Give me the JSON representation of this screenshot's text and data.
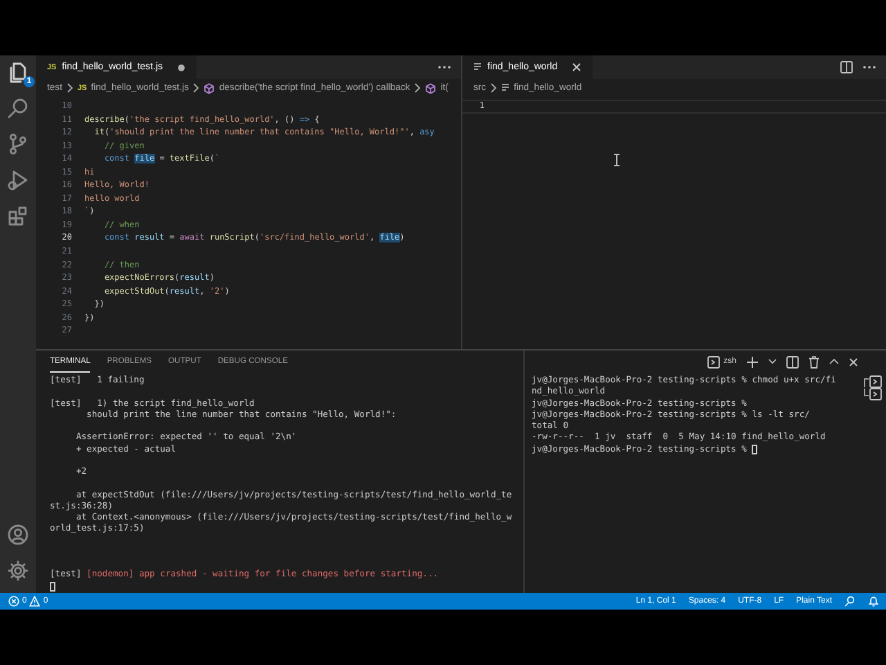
{
  "activity_bar": {
    "explorer_badge": "1"
  },
  "editors": [
    {
      "tab": {
        "badge": "JS",
        "label": "find_hello_world_test.js",
        "modified": true
      },
      "breadcrumbs": [
        {
          "kind": "folder",
          "label": "test"
        },
        {
          "kind": "js",
          "badge": "JS",
          "label": "find_hello_world_test.js"
        },
        {
          "kind": "symbol",
          "label": "describe('the script find_hello_world') callback"
        },
        {
          "kind": "symbol",
          "label": "it("
        }
      ],
      "lines": [
        {
          "number": "10",
          "current": false
        },
        {
          "number": "11",
          "current": false,
          "tokens": [
            {
              "text": "describe",
              "kind": "func"
            },
            {
              "text": "(",
              "kind": "plain"
            },
            {
              "text": "'the script find_hello_world'",
              "kind": "string"
            },
            {
              "text": ", () ",
              "kind": "plain"
            },
            {
              "text": "=>",
              "kind": "keyword"
            },
            {
              "text": " {",
              "kind": "plain"
            }
          ]
        },
        {
          "number": "12",
          "current": false,
          "tokens": [
            {
              "text": "  it",
              "kind": "func"
            },
            {
              "text": "(",
              "kind": "plain"
            },
            {
              "text": "'should print the line number that contains \"Hello, World!\"'",
              "kind": "string"
            },
            {
              "text": ", ",
              "kind": "plain"
            },
            {
              "text": "asy",
              "kind": "keyword"
            }
          ]
        },
        {
          "number": "13",
          "current": false,
          "tokens": [
            {
              "text": "    // given",
              "kind": "comment"
            }
          ]
        },
        {
          "number": "14",
          "current": false,
          "tokens": [
            {
              "text": "    const ",
              "kind": "keyword"
            },
            {
              "text": "file",
              "kind": "match"
            },
            {
              "text": " = ",
              "kind": "plain"
            },
            {
              "text": "textFile",
              "kind": "func"
            },
            {
              "text": "(",
              "kind": "plain"
            },
            {
              "text": "`",
              "kind": "string"
            }
          ]
        },
        {
          "number": "15",
          "current": false,
          "tokens": [
            {
              "text": "hi",
              "kind": "string"
            }
          ]
        },
        {
          "number": "16",
          "current": false,
          "tokens": [
            {
              "text": "Hello, World!",
              "kind": "string"
            }
          ]
        },
        {
          "number": "17",
          "current": false,
          "tokens": [
            {
              "text": "hello world",
              "kind": "string"
            }
          ]
        },
        {
          "number": "18",
          "current": false,
          "tokens": [
            {
              "text": "`",
              "kind": "string"
            },
            {
              "text": ")",
              "kind": "plain"
            }
          ]
        },
        {
          "number": "19",
          "current": false,
          "tokens": [
            {
              "text": "    // when",
              "kind": "comment"
            }
          ]
        },
        {
          "number": "20",
          "current": true,
          "tokens": [
            {
              "text": "    const ",
              "kind": "keyword"
            },
            {
              "text": "result",
              "kind": "var"
            },
            {
              "text": " = ",
              "kind": "plain"
            },
            {
              "text": "await ",
              "kind": "control"
            },
            {
              "text": "runScript",
              "kind": "func"
            },
            {
              "text": "(",
              "kind": "plain"
            },
            {
              "text": "'src/find_hello_world'",
              "kind": "string"
            },
            {
              "text": ", ",
              "kind": "plain"
            },
            {
              "text": "file",
              "kind": "match"
            },
            {
              "text": ")",
              "kind": "plain"
            }
          ]
        },
        {
          "number": "21",
          "current": false
        },
        {
          "number": "22",
          "current": false,
          "tokens": [
            {
              "text": "    // then",
              "kind": "comment"
            }
          ]
        },
        {
          "number": "23",
          "current": false,
          "tokens": [
            {
              "text": "    expectNoErrors",
              "kind": "func"
            },
            {
              "text": "(",
              "kind": "plain"
            },
            {
              "text": "result",
              "kind": "var"
            },
            {
              "text": ")",
              "kind": "plain"
            }
          ]
        },
        {
          "number": "24",
          "current": false,
          "tokens": [
            {
              "text": "    expectStdOut",
              "kind": "func"
            },
            {
              "text": "(",
              "kind": "plain"
            },
            {
              "text": "result",
              "kind": "var"
            },
            {
              "text": ", ",
              "kind": "plain"
            },
            {
              "text": "'2'",
              "kind": "string"
            },
            {
              "text": ")",
              "kind": "plain"
            }
          ]
        },
        {
          "number": "25",
          "current": false,
          "tokens": [
            {
              "text": "  })",
              "kind": "plain"
            }
          ]
        },
        {
          "number": "26",
          "current": false,
          "tokens": [
            {
              "text": "})",
              "kind": "plain"
            }
          ]
        },
        {
          "number": "27",
          "current": false
        }
      ]
    },
    {
      "tab": {
        "label": "find_hello_world",
        "modified": false
      },
      "breadcrumbs": [
        {
          "kind": "folder",
          "label": "src"
        },
        {
          "kind": "file",
          "label": "find_hello_world"
        }
      ],
      "lines": [
        {
          "number": "1",
          "current": true
        }
      ]
    }
  ],
  "panel": {
    "tabs": [
      {
        "label": "TERMINAL",
        "selected": true
      },
      {
        "label": "PROBLEMS",
        "selected": false
      },
      {
        "label": "OUTPUT",
        "selected": false
      },
      {
        "label": "DEBUG CONSOLE",
        "selected": false
      }
    ],
    "shell": "zsh",
    "terminals": [
      {
        "lines": [
          {
            "kind": "text",
            "segments": [
              {
                "text": "[test]   1 failing",
                "kind": "plain"
              }
            ]
          },
          {
            "kind": "blank"
          },
          {
            "kind": "text",
            "segments": [
              {
                "text": "[test]   1) the script find_hello_world",
                "kind": "plain"
              }
            ]
          },
          {
            "kind": "text",
            "segments": [
              {
                "text": "       should print the line number that contains \"Hello, World!\":",
                "kind": "plain"
              }
            ]
          },
          {
            "kind": "blank"
          },
          {
            "kind": "text",
            "segments": [
              {
                "text": "     AssertionError: expected '' to equal '2\\n'",
                "kind": "plain"
              }
            ]
          },
          {
            "kind": "text",
            "segments": [
              {
                "text": "     + expected - actual",
                "kind": "plain"
              }
            ]
          },
          {
            "kind": "blank"
          },
          {
            "kind": "text",
            "segments": [
              {
                "text": "     +2",
                "kind": "plain"
              }
            ]
          },
          {
            "kind": "blank"
          },
          {
            "kind": "text",
            "segments": [
              {
                "text": "     at expectStdOut (file:///Users/jv/projects/testing-scripts/test/find_hello_world_te",
                "kind": "plain"
              }
            ]
          },
          {
            "kind": "text",
            "segments": [
              {
                "text": "st.js:36:28)",
                "kind": "plain"
              }
            ]
          },
          {
            "kind": "text",
            "segments": [
              {
                "text": "     at Context.<anonymous> (file:///Users/jv/projects/testing-scripts/test/find_hello_w",
                "kind": "plain"
              }
            ]
          },
          {
            "kind": "text",
            "segments": [
              {
                "text": "orld_test.js:17:5)",
                "kind": "plain"
              }
            ]
          },
          {
            "kind": "blank"
          },
          {
            "kind": "blank"
          },
          {
            "kind": "blank"
          },
          {
            "kind": "text",
            "segments": [
              {
                "text": "[test] ",
                "kind": "plain"
              },
              {
                "text": "[nodemon] app crashed - waiting for file changes before starting...",
                "kind": "error"
              }
            ]
          },
          {
            "kind": "cursor"
          }
        ]
      },
      {
        "lines": [
          {
            "kind": "text",
            "segments": [
              {
                "text": "jv@Jorges-MacBook-Pro-2 testing-scripts % chmod u+x src/fi",
                "kind": "plain"
              }
            ]
          },
          {
            "kind": "text",
            "segments": [
              {
                "text": "nd_hello_world",
                "kind": "plain"
              }
            ]
          },
          {
            "kind": "text",
            "segments": [
              {
                "text": "jv@Jorges-MacBook-Pro-2 testing-scripts %",
                "kind": "plain"
              }
            ]
          },
          {
            "kind": "text",
            "segments": [
              {
                "text": "jv@Jorges-MacBook-Pro-2 testing-scripts % ls -lt src/",
                "kind": "plain"
              }
            ]
          },
          {
            "kind": "text",
            "segments": [
              {
                "text": "total 0",
                "kind": "plain"
              }
            ]
          },
          {
            "kind": "text",
            "segments": [
              {
                "text": "-rw-r--r--  1 jv  staff  0  5 May 14:10 find_hello_world",
                "kind": "plain"
              }
            ]
          },
          {
            "kind": "cursor",
            "segments": [
              {
                "text": "jv@Jorges-MacBook-Pro-2 testing-scripts % ",
                "kind": "plain"
              }
            ]
          }
        ]
      }
    ]
  },
  "status_bar": {
    "errors": "0",
    "warnings": "0",
    "items": [
      "Ln 1, Col 1",
      "Spaces: 4",
      "UTF-8",
      "LF",
      "Plain Text"
    ]
  }
}
